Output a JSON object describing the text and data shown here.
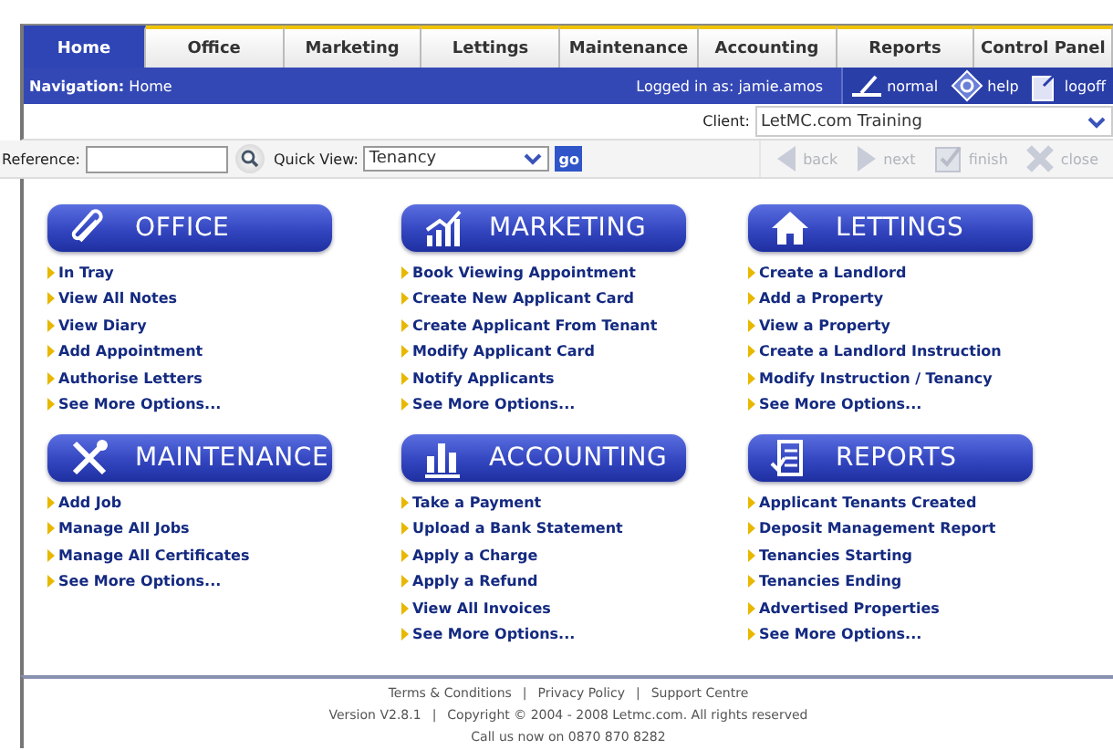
{
  "tabs": [
    {
      "label": "Home",
      "selected": true
    },
    {
      "label": "Office",
      "selected": false
    },
    {
      "label": "Marketing",
      "selected": false
    },
    {
      "label": "Lettings",
      "selected": false
    },
    {
      "label": "Maintenance",
      "selected": false
    },
    {
      "label": "Accounting",
      "selected": false
    },
    {
      "label": "Reports",
      "selected": false
    },
    {
      "label": "Control Panel",
      "selected": false
    }
  ],
  "nav": {
    "label": "Navigation:",
    "value": "Home",
    "logged_in": "Logged in as: jamie.amos",
    "actions": [
      "normal",
      "help",
      "logoff"
    ]
  },
  "client": {
    "label": "Client:",
    "value": "LetMC.com Training"
  },
  "toolbar": {
    "reference_label": "Reference:",
    "quick_view_label": "Quick View:",
    "quick_view_value": "Tenancy",
    "go": "go",
    "steps": [
      {
        "label": "back",
        "disabled": true
      },
      {
        "label": "next",
        "disabled": true
      },
      {
        "label": "finish",
        "disabled": true
      },
      {
        "label": "close",
        "disabled": true
      }
    ]
  },
  "sections": [
    {
      "kind": "office",
      "title": "OFFICE",
      "links": [
        "In Tray",
        "View All Notes",
        "View Diary",
        "Add Appointment",
        "Authorise Letters",
        "See More Options..."
      ]
    },
    {
      "kind": "marketing",
      "title": "MARKETING",
      "links": [
        "Book Viewing Appointment",
        "Create New Applicant Card",
        "Create Applicant From Tenant",
        "Modify Applicant Card",
        "Notify Applicants",
        "See More Options..."
      ]
    },
    {
      "kind": "lettings",
      "title": "LETTINGS",
      "links": [
        "Create a Landlord",
        "Add a Property",
        "View a Property",
        "Create a Landlord Instruction",
        "Modify Instruction / Tenancy",
        "See More Options..."
      ]
    },
    {
      "kind": "maintenance",
      "title": "MAINTENANCE",
      "links": [
        "Add Job",
        "Manage All Jobs",
        "Manage All Certificates",
        "See More Options..."
      ]
    },
    {
      "kind": "accounting",
      "title": "ACCOUNTING",
      "links": [
        "Take a Payment",
        "Upload a Bank Statement",
        "Apply a Charge",
        "Apply a Refund",
        "View All Invoices",
        "See More Options..."
      ]
    },
    {
      "kind": "reports",
      "title": "REPORTS",
      "links": [
        "Applicant Tenants Created",
        "Deposit Management Report",
        "Tenancies Starting",
        "Tenancies Ending",
        "Advertised Properties",
        "See More Options..."
      ]
    }
  ],
  "footer": {
    "separator": "|",
    "links": [
      "Terms & Conditions",
      "Privacy Policy",
      "Support Centre"
    ],
    "version": "Version V2.8.1",
    "copyright": "Copyright © 2004 - 2008 Letmc.com. All rights reserved",
    "call": "Call us now on 0870 870 8282"
  }
}
